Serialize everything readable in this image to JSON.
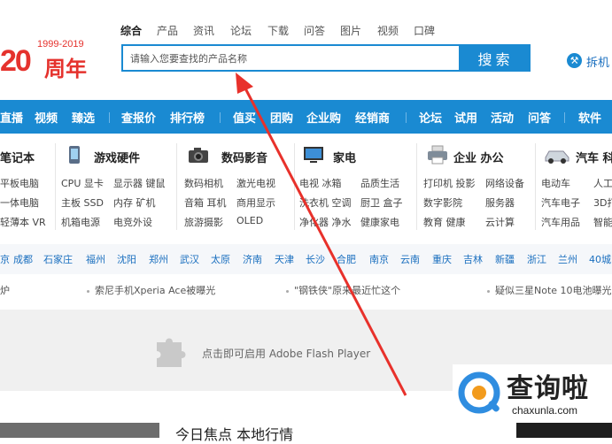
{
  "logo": {
    "years": "1999-2019",
    "big": "20",
    "cn": "周年"
  },
  "search_tabs": [
    "综合",
    "产品",
    "资讯",
    "论坛",
    "下载",
    "问答",
    "图片",
    "视频",
    "口碑"
  ],
  "search": {
    "placeholder": "请输入您要查找的产品名称",
    "button": "搜索"
  },
  "tool": {
    "label": "拆机"
  },
  "nav": [
    "直播",
    "视频",
    "臻选",
    "查报价",
    "排行榜",
    "值买",
    "团购",
    "企业购",
    "经销商",
    "论坛",
    "试用",
    "活动",
    "问答",
    "软件"
  ],
  "categories": [
    {
      "title": "笔记本",
      "links": [
        "平板电脑",
        "一体电脑",
        "轻薄本 VR"
      ]
    },
    {
      "title": "游戏硬件",
      "links": [
        "CPU 显卡",
        "显示器 键鼠",
        "主板 SSD",
        "内存 矿机",
        "机箱电源",
        "电竞外设"
      ]
    },
    {
      "title": "数码影音",
      "links": [
        "数码相机",
        "激光电视",
        "音箱 耳机",
        "商用显示",
        "旅游摄影",
        "OLED"
      ]
    },
    {
      "title": "家电",
      "links": [
        "电视 冰箱",
        "品质生活",
        "洗衣机 空调",
        "厨卫 盒子",
        "净化器 净水",
        "健康家电"
      ]
    },
    {
      "title": "企业 办公",
      "links": [
        "打印机 投影",
        "网络设备",
        "数字影院",
        "服务器",
        "教育 健康",
        "云计算"
      ]
    },
    {
      "title": "汽车 科",
      "links": [
        "电动车",
        "人工",
        "汽车电子",
        "3D打",
        "汽车用品",
        "智能"
      ]
    }
  ],
  "cities": [
    "京",
    "成都",
    "石家庄",
    "福州",
    "沈阳",
    "郑州",
    "武汉",
    "太原",
    "济南",
    "天津",
    "长沙",
    "合肥",
    "南京",
    "云南",
    "重庆",
    "吉林",
    "新疆",
    "浙江",
    "兰州",
    "40城"
  ],
  "news": [
    "炉",
    "索尼手机Xperia Ace被曝光",
    "\"钢铁侠\"原来最近忙这个",
    "疑似三星Note 10电池曝光"
  ],
  "flash": {
    "text": "点击即可启用 Adobe Flash Player"
  },
  "focus": {
    "title": "今日焦点   本地行情"
  },
  "watermark": {
    "text": "查询啦",
    "url": "chaxunla.com"
  },
  "colors": {
    "brand_blue": "#1a8ad2",
    "logo_red": "#e5322d",
    "arrow_red": "#e8312b"
  }
}
